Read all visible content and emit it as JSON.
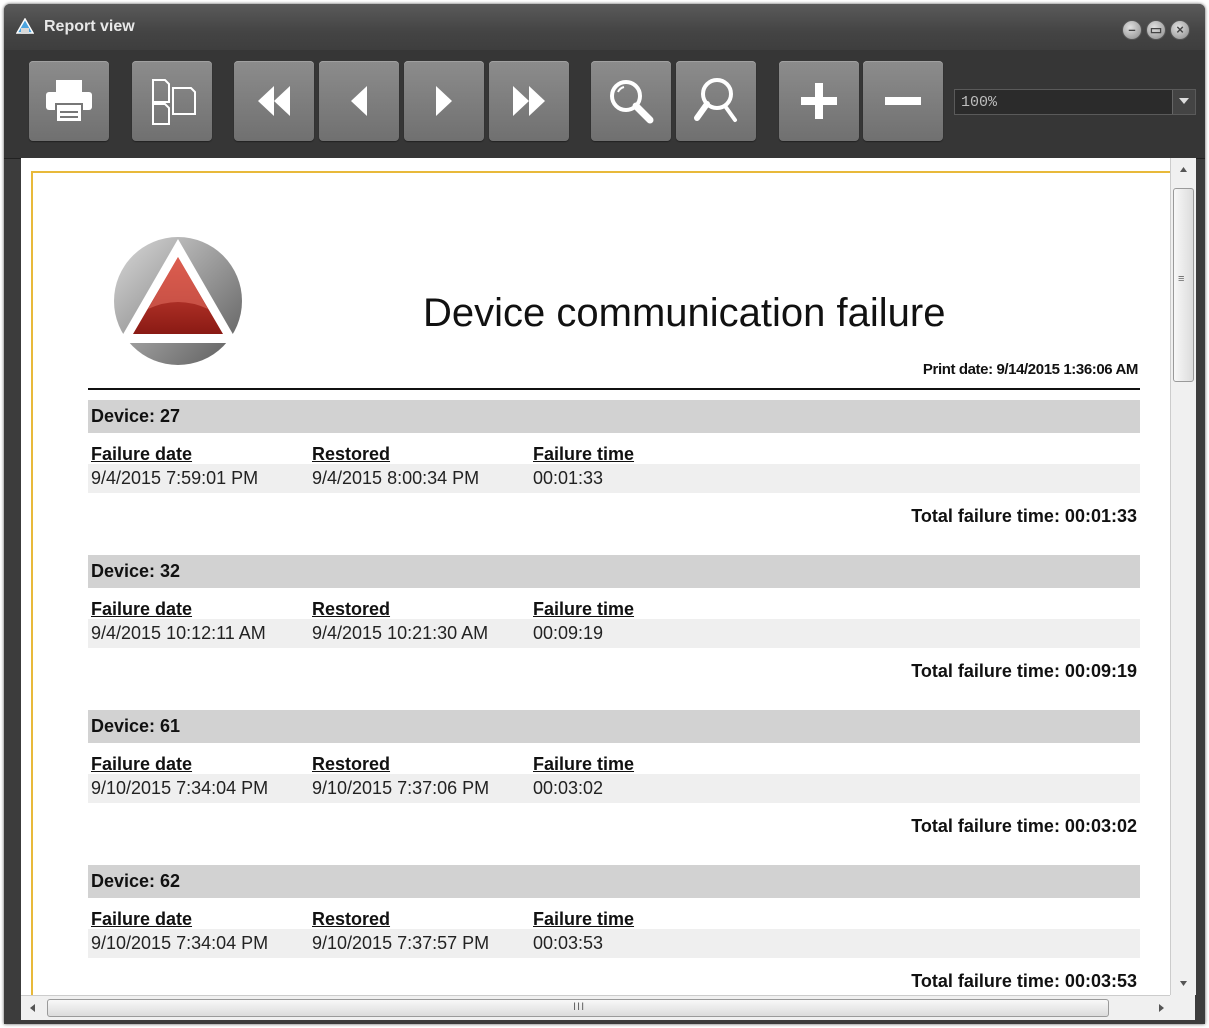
{
  "window": {
    "title": "Report view"
  },
  "toolbar": {
    "buttons": [
      "print-icon",
      "page-layout-icon",
      "first-page-icon",
      "previous-page-icon",
      "next-page-icon",
      "last-page-icon",
      "zoom-icon",
      "zoom-fit-icon",
      "zoom-in-icon",
      "zoom-out-icon"
    ],
    "zoom_value": "100%"
  },
  "report": {
    "title": "Device communication failure",
    "print_date": "Print date: 9/14/2015 1:36:06 AM",
    "columns": [
      "Failure date",
      "Restored",
      "Failure time"
    ],
    "devices": [
      {
        "header": "Device: 27",
        "failure_date": "9/4/2015 7:59:01 PM",
        "restored": "9/4/2015 8:00:34 PM",
        "failure_time": "00:01:33",
        "total": "Total failure time: 00:01:33"
      },
      {
        "header": "Device: 32",
        "failure_date": "9/4/2015 10:12:11 AM",
        "restored": "9/4/2015 10:21:30 AM",
        "failure_time": "00:09:19",
        "total": "Total failure time: 00:09:19"
      },
      {
        "header": "Device: 61",
        "failure_date": "9/10/2015 7:34:04 PM",
        "restored": "9/10/2015 7:37:06 PM",
        "failure_time": "00:03:02",
        "total": "Total failure time: 00:03:02"
      },
      {
        "header": "Device: 62",
        "failure_date": "9/10/2015 7:34:04 PM",
        "restored": "9/10/2015 7:37:57 PM",
        "failure_time": "00:03:53",
        "total": "Total failure time: 00:03:53"
      }
    ]
  },
  "colors": {
    "accent_border": "#e8b93a",
    "logo_red": "#b8221c",
    "toolbar_bg": "#363636"
  }
}
